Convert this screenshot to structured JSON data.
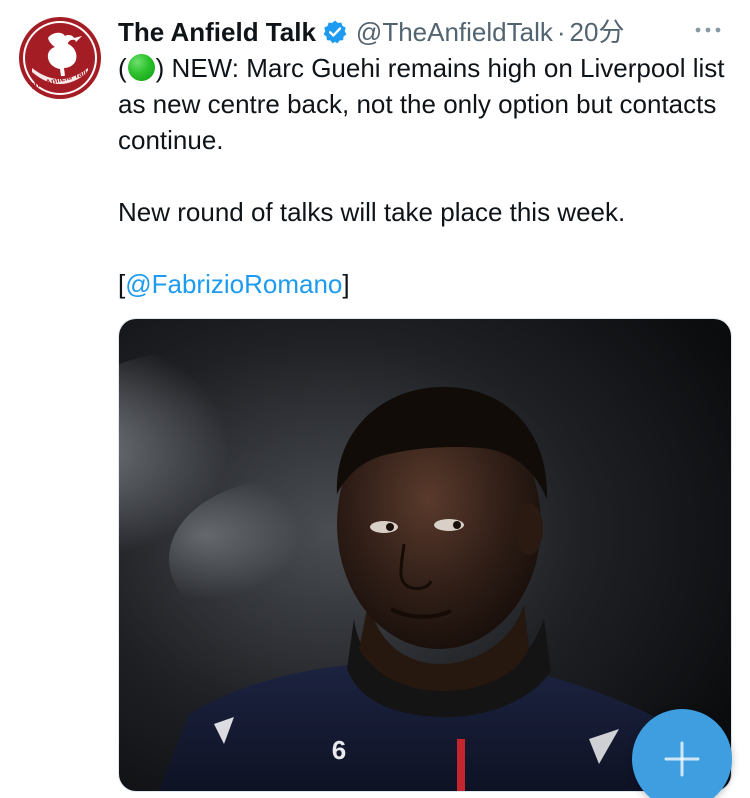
{
  "account": {
    "display_name": "The Anfield Talk",
    "handle": "@TheAnfieldTalk",
    "separator": "·",
    "timestamp": "20分",
    "avatar_icon": "liver-bird-logo-icon",
    "avatar_text": "The Anfield Talk",
    "verified_color": "#1d9bf0"
  },
  "tweet": {
    "line_open": "(",
    "line_rest": ") NEW: Marc Guehi remains high on Liverpool list as new centre back, not the only option but contacts continue.",
    "paragraph_2": "New round of talks will take place this week.",
    "source_open": "[",
    "mention": "@FabrizioRomano",
    "source_close": "]",
    "status_emoji": "green-circle-emoji"
  },
  "media": {
    "description_icon": "player-photo",
    "shirt_number": "6"
  },
  "compose": {
    "icon": "plus-icon"
  },
  "colors": {
    "accent": "#1d9bf0",
    "fab": "#3e9ee0",
    "logo_red": "#a51d24",
    "text_secondary": "#536471"
  }
}
